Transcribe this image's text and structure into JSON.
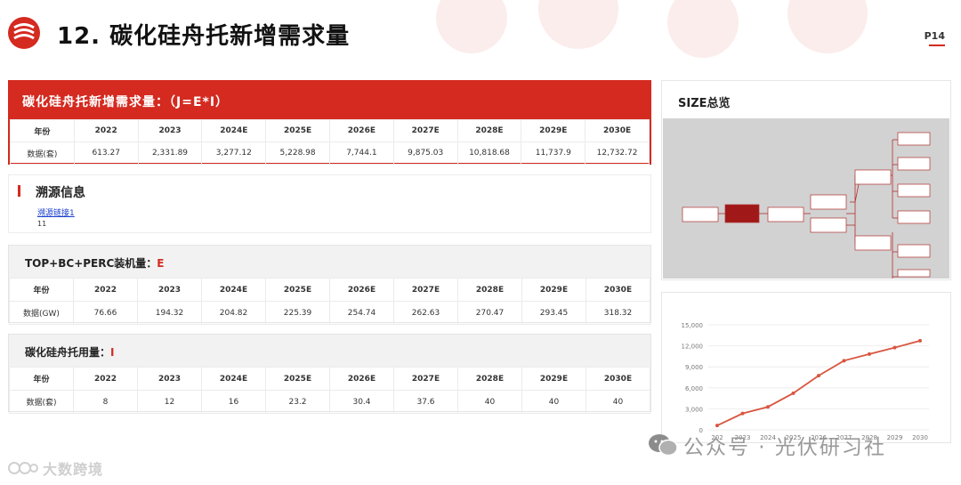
{
  "header": {
    "title": "12.  碳化硅舟托新增需求量",
    "page_number": "P14",
    "accent_color": "#d42a20"
  },
  "main_table": {
    "title": "碳化硅舟托新增需求量：（J=E*I）",
    "row_labels": [
      "年份",
      "数据(套)"
    ],
    "years": [
      "2022",
      "2023",
      "2024E",
      "2025E",
      "2026E",
      "2027E",
      "2028E",
      "2029E",
      "2030E"
    ],
    "values": [
      "613.27",
      "2,331.89",
      "3,277.12",
      "5,228.98",
      "7,744.1",
      "9,875.03",
      "10,818.68",
      "11,737.9",
      "12,732.72"
    ]
  },
  "trace": {
    "title": "溯源信息",
    "link_text": "溯源链接1",
    "number": "11"
  },
  "table_e": {
    "title": "TOP+BC+PERC装机量：",
    "accent": "E",
    "row_labels": [
      "年份",
      "数据(GW)"
    ],
    "years": [
      "2022",
      "2023",
      "2024E",
      "2025E",
      "2026E",
      "2027E",
      "2028E",
      "2029E",
      "2030E"
    ],
    "values": [
      "76.66",
      "194.32",
      "204.82",
      "225.39",
      "254.74",
      "262.63",
      "270.47",
      "293.45",
      "318.32"
    ]
  },
  "table_i": {
    "title": "碳化硅舟托用量：",
    "accent": "I",
    "row_labels": [
      "年份",
      "数据(套)"
    ],
    "years": [
      "2022",
      "2023",
      "2024E",
      "2025E",
      "2026E",
      "2027E",
      "2028E",
      "2029E",
      "2030E"
    ],
    "values": [
      "8",
      "12",
      "16",
      "23.2",
      "30.4",
      "37.6",
      "40",
      "40",
      "40"
    ]
  },
  "size_panel": {
    "title": "SIZE总览"
  },
  "chart_data": {
    "type": "line",
    "x": [
      "2022",
      "2023",
      "2024",
      "2025",
      "2026",
      "2027",
      "2028",
      "2029",
      "2030"
    ],
    "x_tick_labels": [
      "202",
      "2023",
      "2024",
      "2025",
      "2026",
      "2027",
      "2028",
      "2029",
      "2030"
    ],
    "series": [
      {
        "values": [
          613.27,
          2331.89,
          3277.12,
          5228.98,
          7744.1,
          9875.03,
          10818.68,
          11737.9,
          12732.72
        ],
        "color": "#d9553f"
      }
    ],
    "y_ticks": [
      "0",
      "3,000",
      "6,000",
      "9,000",
      "12,000",
      "15,000"
    ],
    "ylim": [
      0,
      15000
    ],
    "grid": true,
    "legend": "none"
  },
  "watermarks": {
    "right": "公众号 · 光伏研习社",
    "left": "大数跨境"
  }
}
